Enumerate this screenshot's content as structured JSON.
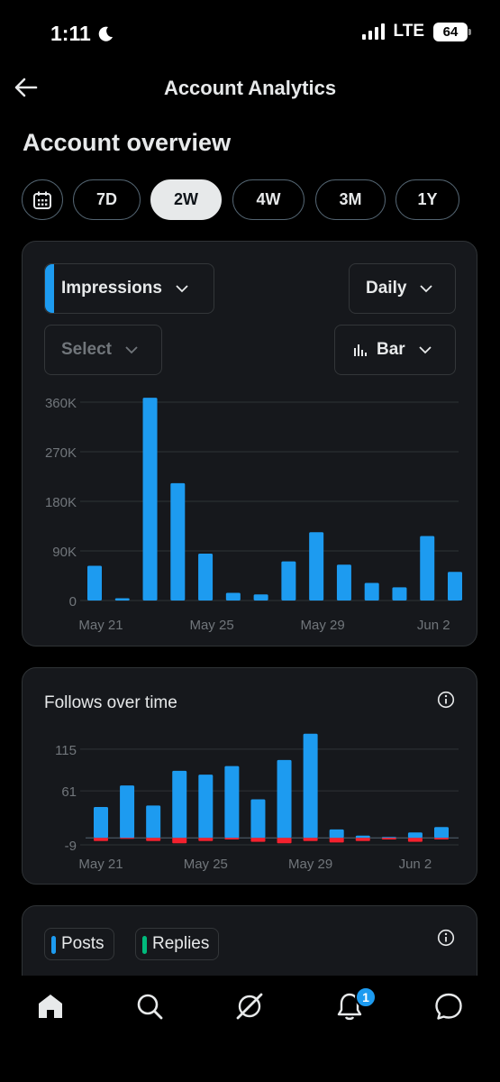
{
  "status": {
    "time": "1:11",
    "network": "LTE",
    "battery": "64",
    "icons": [
      "moon-icon",
      "signal-icon",
      "battery-icon"
    ]
  },
  "header": {
    "title": "Account Analytics",
    "back_icon": "back-arrow-icon"
  },
  "overview_title": "Account overview",
  "ranges": {
    "calendar_icon": "calendar-icon",
    "items": [
      "7D",
      "2W",
      "4W",
      "3M",
      "1Y"
    ],
    "active": "2W"
  },
  "impressions_card": {
    "metric": "Impressions",
    "interval": "Daily",
    "compare": "Select",
    "chart_kind": "Bar",
    "accent_color": "#1d9bf0"
  },
  "follows_card": {
    "title": "Follows over time",
    "info_icon": "info-icon"
  },
  "posts_card": {
    "chips": [
      "Posts",
      "Replies"
    ],
    "colors": [
      "#1d9bf0",
      "#00ba7c"
    ],
    "info_icon": "info-icon"
  },
  "tabbar": {
    "items": [
      "home-icon",
      "search-icon",
      "grok-icon",
      "notifications-icon",
      "messages-icon"
    ],
    "notification_badge": "1"
  },
  "chart_data": [
    {
      "type": "bar",
      "title": "",
      "x_ticks": [
        "May 21",
        "May 25",
        "May 29",
        "Jun 2"
      ],
      "y_ticks": [
        "360K",
        "270K",
        "180K",
        "90K",
        "0"
      ],
      "ylim": [
        0,
        360000
      ],
      "grid": true,
      "color": "#1d9bf0",
      "categories": [
        "May 21",
        "May 22",
        "May 23",
        "May 24",
        "May 25",
        "May 26",
        "May 27",
        "May 28",
        "May 29",
        "May 30",
        "May 31",
        "Jun 1",
        "Jun 2",
        "Jun 3"
      ],
      "values": [
        63000,
        4000,
        368000,
        213000,
        85000,
        14000,
        11000,
        71000,
        124000,
        65000,
        32000,
        24000,
        117000,
        52000
      ]
    },
    {
      "type": "bar",
      "title": "Follows over time",
      "x_ticks": [
        "May 21",
        "May 25",
        "May 29",
        "Jun 2"
      ],
      "y_ticks": [
        "115",
        "61",
        "-9"
      ],
      "ylim": [
        -9,
        130
      ],
      "grid": true,
      "categories": [
        "May 21",
        "May 22",
        "May 23",
        "May 24",
        "May 25",
        "May 26",
        "May 27",
        "May 28",
        "May 29",
        "May 30",
        "May 31",
        "Jun 1",
        "Jun 2",
        "Jun 3"
      ],
      "series": [
        {
          "color": "#1d9bf0",
          "values": [
            40,
            68,
            42,
            87,
            82,
            93,
            50,
            101,
            135,
            11,
            3,
            1,
            7,
            14
          ]
        },
        {
          "color": "#f4212e",
          "values": [
            -4,
            -1,
            -4,
            -7,
            -4,
            -2,
            -5,
            -7,
            -4,
            -6,
            -4,
            -2,
            -5,
            -2
          ]
        }
      ]
    }
  ]
}
